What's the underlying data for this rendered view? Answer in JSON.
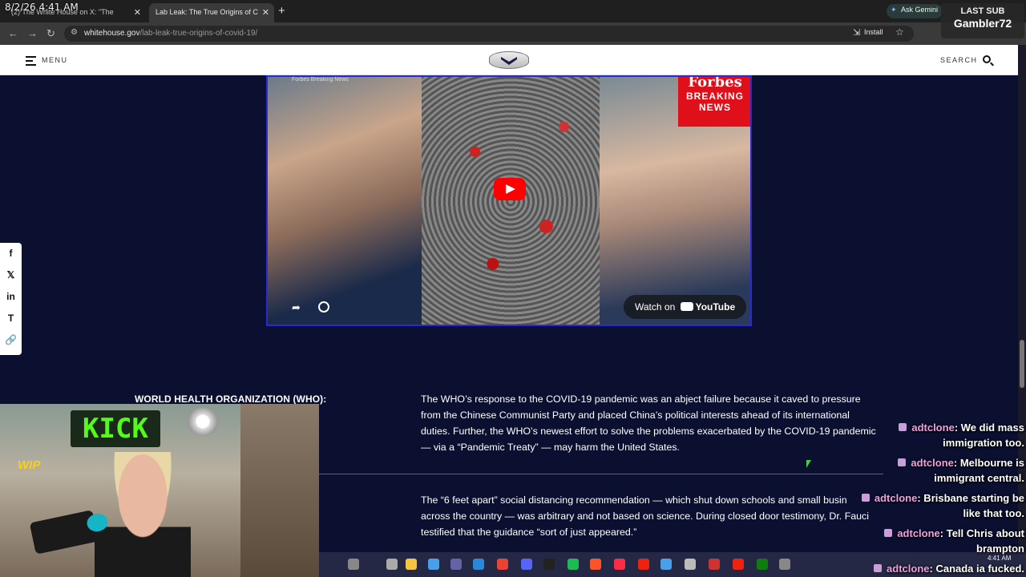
{
  "timestamp": "8/2/26 4:41 AM",
  "browser": {
    "tabs": [
      {
        "label": "(2) The White House on X: \"The"
      },
      {
        "label": "Lab Leak: The True Origins of C"
      }
    ],
    "url_host": "whitehouse.gov",
    "url_path": "/lab-leak-true-origins-of-covid-19/",
    "install_label": "Install",
    "gemini_label": "Ask Gemini"
  },
  "site": {
    "menu_label": "MENU",
    "search_label": "SEARCH"
  },
  "video": {
    "channel": "Forbes Breaking News",
    "forbes_title": "Forbes",
    "forbes_sub": "BREAKING NEWS",
    "watch_on": "Watch on",
    "youtube": "YouTube"
  },
  "content": {
    "who_heading": "WORLD HEALTH ORGANIZATION (WHO):",
    "para1": "The WHO’s response to the COVID-19 pandemic was an abject failure because it caved to pressure from the Chinese Communist Party and placed China’s political interests ahead of its international duties. Further, the WHO’s newest effort to solve the problems exacerbated by the COVID-19 pandemic — via a “Pandemic Treaty” — may harm the United States.",
    "para2": "The “6 feet apart” social distancing recommendation — which shut down schools and small busin across the country — was arbitrary and not based on science. During closed door testimony, Dr. Fauci testified that the guidance “sort of just appeared.”"
  },
  "stream": {
    "last_sub_label": "LAST SUB",
    "last_sub_name": "Gambler72",
    "kick_label": "KICK",
    "wip_label": "WIP",
    "taskbar_time": "4:41 AM",
    "chat": [
      {
        "user": "adtclone",
        "line1": ": We did mass",
        "line2": "immigration too."
      },
      {
        "user": "adtclone",
        "line1": ": Melbourne is",
        "line2": "immigrant central."
      },
      {
        "user": "adtclone",
        "line1": ": Brisbane starting be",
        "line2": "like that too."
      },
      {
        "user": "adtclone",
        "line1": ": Tell Chris about",
        "line2": "brampton"
      },
      {
        "user": "adtclone",
        "line1": ": Canada ia fucked.",
        "line2": ""
      }
    ]
  }
}
